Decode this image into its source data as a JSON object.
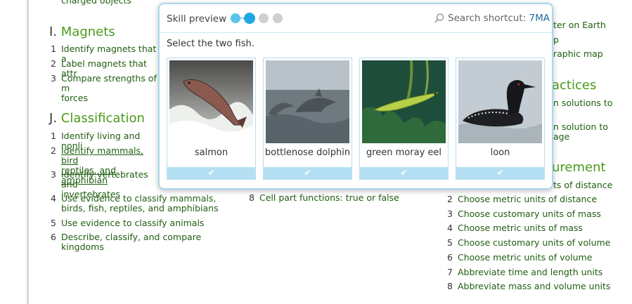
{
  "background": {
    "top_cut_text": "charged objects",
    "sections": {
      "magnets": {
        "letter": "I.",
        "title": "Magnets",
        "items": [
          {
            "n": "1",
            "text": "Identify magnets that a"
          },
          {
            "n": "2",
            "text": "Label magnets that attr"
          },
          {
            "n": "3",
            "text": "Compare strengths of m\nforces"
          }
        ]
      },
      "classification": {
        "letter": "J.",
        "title": "Classification",
        "items": [
          {
            "n": "1",
            "text": "Identify living and nonli"
          },
          {
            "n": "2",
            "text": "Identify mammals, bird\nreptiles, and amphibian"
          },
          {
            "n": "3",
            "text": "Identify vertebrates and\ninvertebrates"
          },
          {
            "n": "4",
            "text": "Use evidence to classify mammals,\nbirds, fish, reptiles, and amphibians"
          },
          {
            "n": "5",
            "text": "Use evidence to classify animals"
          },
          {
            "n": "6",
            "text": "Describe, classify, and compare\nkingdoms"
          }
        ]
      },
      "middle": {
        "items": [
          {
            "n": "8",
            "text": "Cell part functions: true or false"
          }
        ]
      },
      "right_cut": [
        "ter on Earth",
        "p",
        "raphic map",
        "actices",
        "n solutions to",
        "n solution to",
        "age",
        "urement",
        "ts of distance"
      ],
      "measurement": {
        "items": [
          {
            "n": "2",
            "text": "Choose metric units of distance"
          },
          {
            "n": "3",
            "text": "Choose customary units of mass"
          },
          {
            "n": "4",
            "text": "Choose metric units of mass"
          },
          {
            "n": "5",
            "text": "Choose customary units of volume"
          },
          {
            "n": "6",
            "text": "Choose metric units of volume"
          },
          {
            "n": "7",
            "text": "Abbreviate time and length units"
          },
          {
            "n": "8",
            "text": "Abbreviate mass and volume units"
          }
        ]
      }
    }
  },
  "popup": {
    "label": "Skill preview",
    "progress": {
      "total": 4,
      "current": 2
    },
    "search_label": "Search shortcut:",
    "search_code": "7MA",
    "question": "Select the two fish.",
    "choices": [
      {
        "label": "salmon",
        "icon": "salmon-photo"
      },
      {
        "label": "bottlenose dolphin",
        "icon": "dolphin-photo"
      },
      {
        "label": "green moray eel",
        "icon": "eel-photo"
      },
      {
        "label": "loon",
        "icon": "loon-photo"
      }
    ],
    "check_glyph": "✔"
  },
  "colors": {
    "section_title": "#4a9a1a",
    "skill_link": "#1f5e10",
    "accent": "#1ea7e0",
    "popup_border": "#a9d8ee"
  }
}
